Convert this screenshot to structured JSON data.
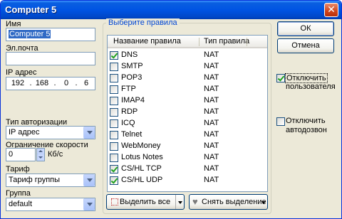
{
  "window": {
    "title": "Computer 5",
    "close_glyph": "✕"
  },
  "left": {
    "name_label": "Имя",
    "name_value": "Computer 5",
    "email_label": "Эл.почта",
    "email_value": "",
    "ip_label": "IP адрес",
    "ip_parts": [
      "192",
      "168",
      "0",
      "6"
    ],
    "auth_label": "Тип авторизации",
    "auth_value": "IP адрес",
    "speed_label": "Ограничение скорости",
    "speed_value": "0",
    "speed_unit": "Кб/с",
    "tariff_label": "Тариф",
    "tariff_value": "Тариф группы",
    "group_label": "Группа",
    "group_value": "default"
  },
  "rules": {
    "group_title": "Выберите правила",
    "col_name": "Название правила",
    "col_type": "Тип правила",
    "items": [
      {
        "name": "DNS",
        "type": "NAT",
        "checked": true
      },
      {
        "name": "SMTP",
        "type": "NAT",
        "checked": false
      },
      {
        "name": "POP3",
        "type": "NAT",
        "checked": false
      },
      {
        "name": "FTP",
        "type": "NAT",
        "checked": false
      },
      {
        "name": "IMAP4",
        "type": "NAT",
        "checked": false
      },
      {
        "name": "RDP",
        "type": "NAT",
        "checked": false
      },
      {
        "name": "ICQ",
        "type": "NAT",
        "checked": false
      },
      {
        "name": "Telnet",
        "type": "NAT",
        "checked": false
      },
      {
        "name": "WebMoney",
        "type": "NAT",
        "checked": false
      },
      {
        "name": "Lotus Notes",
        "type": "NAT",
        "checked": false
      },
      {
        "name": "CS/HL TCP",
        "type": "NAT",
        "checked": true
      },
      {
        "name": "CS/HL UDP",
        "type": "NAT",
        "checked": true
      }
    ],
    "select_all_label": "Выделить все",
    "deselect_label": "Снять выделение"
  },
  "right": {
    "ok_label": "ОК",
    "cancel_label": "Отмена",
    "disable_user_line1": "Отключить",
    "disable_user_line2": "пользователя",
    "disable_user_checked": true,
    "disable_autodial_line1": "Отключить",
    "disable_autodial_line2": "автодозвон",
    "disable_autodial_checked": false
  },
  "colors": {
    "titlebar": "#0054E3",
    "dialog_bg": "#ECE9D8",
    "group_title": "#0046D5",
    "check_mark": "#21A121",
    "selection": "#316AC5"
  }
}
